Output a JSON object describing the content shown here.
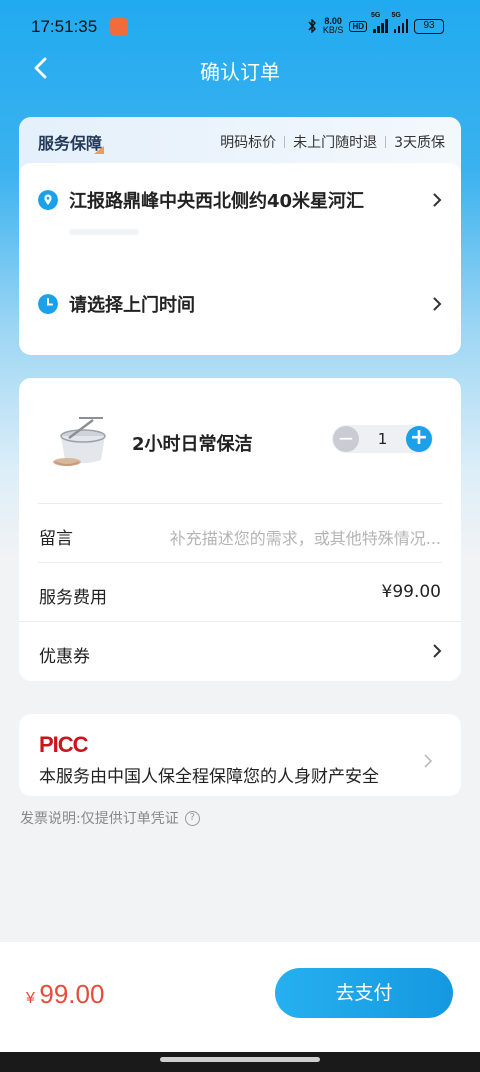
{
  "status_bar": {
    "time": "17:51:35",
    "speed_value": "8.00",
    "speed_unit": "KB/S",
    "hd": "HD",
    "sig1": "5G",
    "sig2": "5G",
    "battery": "93"
  },
  "header": {
    "title": "确认订单"
  },
  "guarantee": {
    "title": "服务保障",
    "items": [
      "明码标价",
      "未上门随时退",
      "3天质保"
    ]
  },
  "address": {
    "location": "江报路鼎峰中央西北侧约40米星河汇",
    "time_prompt": "请选择上门时间"
  },
  "service": {
    "name": "2小时日常保洁",
    "quantity": "1",
    "minus": "−",
    "plus": "+",
    "message_label": "留言",
    "message_placeholder": "补充描述您的需求，或其他特殊情况...",
    "fee_label": "服务费用",
    "fee_value": "¥99.00",
    "coupon_label": "优惠券"
  },
  "picc": {
    "logo": "PICC",
    "text": "本服务由中国人保全程保障您的人身财产安全"
  },
  "invoice": {
    "text": "发票说明:仅提供订单凭证",
    "help": "?"
  },
  "footer": {
    "currency": "¥",
    "total": "99.00",
    "pay_label": "去支付"
  },
  "colors": {
    "accent": "#1aa1ea",
    "price": "#e64b3c",
    "picc": "#d0121b"
  }
}
